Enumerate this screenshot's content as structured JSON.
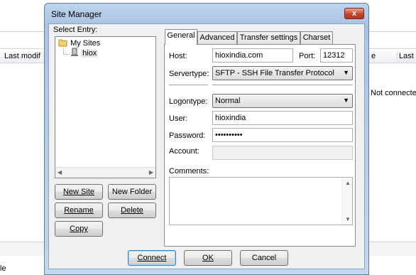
{
  "background": {
    "columns": {
      "left_last_modified": "Last modif",
      "right_partial": "e",
      "right_last_modified": "Last m"
    },
    "status": "Not connected",
    "bottom_text": "le"
  },
  "dialog": {
    "title": "Site Manager",
    "close_glyph": "x",
    "select_entry_label": "Select Entry:",
    "tree": {
      "root": "My Sites",
      "child": "hiox"
    },
    "buttons": {
      "new_site": "New Site",
      "new_folder": "New Folder",
      "rename": "Rename",
      "delete": "Delete",
      "copy": "Copy",
      "connect": "Connect",
      "ok": "OK",
      "cancel": "Cancel"
    },
    "tabs": [
      "General",
      "Advanced",
      "Transfer settings",
      "Charset"
    ],
    "active_tab": "General",
    "general": {
      "host_label": "Host:",
      "host_value": "hioxindia.com",
      "port_label": "Port:",
      "port_value": "12312",
      "servertype_label": "Servertype:",
      "servertype_value": "SFTP - SSH File Transfer Protocol",
      "logontype_label": "Logontype:",
      "logontype_value": "Normal",
      "user_label": "User:",
      "user_value": "hioxindia",
      "password_label": "Password:",
      "password_value": "••••••••••",
      "account_label": "Account:",
      "account_value": "",
      "comments_label": "Comments:"
    }
  }
}
